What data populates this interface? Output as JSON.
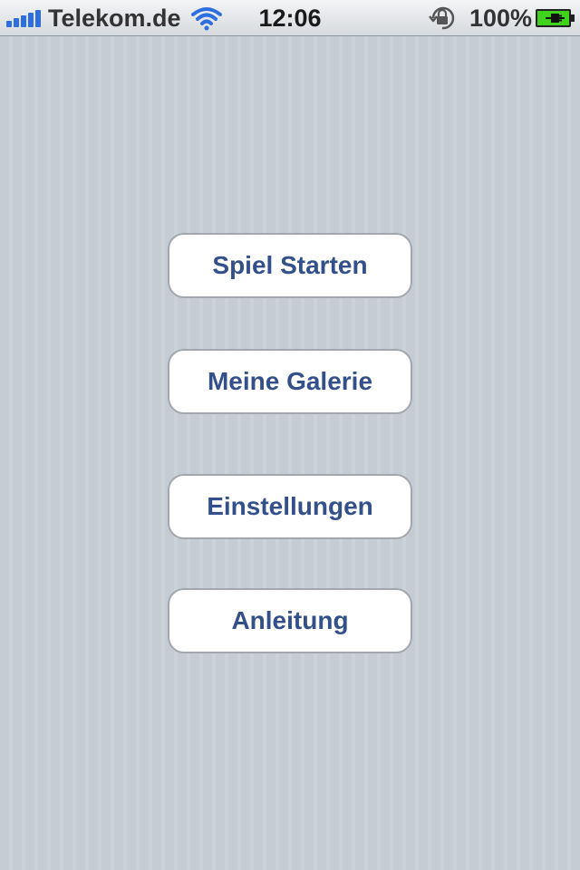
{
  "status_bar": {
    "carrier": "Telekom.de",
    "time": "12:06",
    "battery_percent": "100%",
    "icons": [
      "signal-icon",
      "wifi-icon",
      "rotation-lock-icon",
      "battery-charging-icon"
    ]
  },
  "menu": {
    "buttons": [
      {
        "label": "Spiel Starten"
      },
      {
        "label": "Meine Galerie"
      },
      {
        "label": "Einstellungen"
      },
      {
        "label": "Anleitung"
      }
    ]
  },
  "colors": {
    "background": "#c5ccd4",
    "button_text": "#33508a",
    "signal_blue": "#2d6fe0",
    "battery_green": "#3fd21c"
  }
}
